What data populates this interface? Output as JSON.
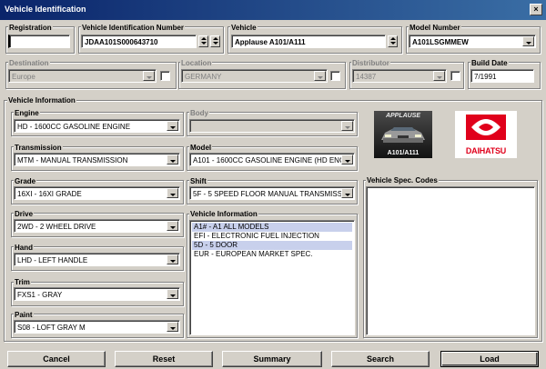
{
  "window": {
    "title": "Vehicle Identification"
  },
  "top": {
    "registration": {
      "label": "Registration",
      "value": ""
    },
    "vin": {
      "label": "Vehicle Identification Number",
      "value": "JDAA101S000643710"
    },
    "vehicle": {
      "label": "Vehicle",
      "value": "Applause A101/A111"
    },
    "model_number": {
      "label": "Model Number",
      "value": "A101LSGMMEW"
    },
    "destination": {
      "label": "Destination",
      "value": "Europe"
    },
    "location": {
      "label": "Location",
      "value": "GERMANY"
    },
    "distributor": {
      "label": "Distributor",
      "value": "14387"
    },
    "build_date": {
      "label": "Build Date",
      "value": "7/1991"
    }
  },
  "info": {
    "label": "Vehicle Information",
    "engine": {
      "label": "Engine",
      "value": "HD - 1600CC GASOLINE ENGINE"
    },
    "body": {
      "label": "Body",
      "value": ""
    },
    "transmission": {
      "label": "Transmission",
      "value": "MTM - MANUAL TRANSMISSION"
    },
    "model": {
      "label": "Model",
      "value": "A101 - 1600CC GASOLINE ENGINE (HD ENGI"
    },
    "grade": {
      "label": "Grade",
      "value": "16XI - 16XI GRADE"
    },
    "shift": {
      "label": "Shift",
      "value": "5F - 5 SPEED FLOOR MANUAL TRANSMISSI"
    },
    "drive": {
      "label": "Drive",
      "value": "2WD - 2 WHEEL DRIVE"
    },
    "hand": {
      "label": "Hand",
      "value": "LHD - LEFT HANDLE"
    },
    "trim": {
      "label": "Trim",
      "value": "FXS1 - GRAY"
    },
    "paint": {
      "label": "Paint",
      "value": "S08 - LOFT GRAY M"
    },
    "list_label": "Vehicle Information",
    "list": [
      {
        "text": "A1# - A1 ALL MODELS",
        "selected": true
      },
      {
        "text": "EFI - ELECTRONIC FUEL INJECTION",
        "selected": false
      },
      {
        "text": "5D - 5 DOOR",
        "selected": true
      },
      {
        "text": "EUR - EUROPEAN MARKET SPEC.",
        "selected": false
      }
    ]
  },
  "images": {
    "car_brand": "APPLAUSE",
    "car_model": "A101/A111",
    "logo_text": "DAIHATSU"
  },
  "spec_codes": {
    "label": "Vehicle Spec. Codes"
  },
  "buttons": {
    "cancel": "Cancel",
    "reset": "Reset",
    "summary": "Summary",
    "search": "Search",
    "load": "Load"
  },
  "colors": {
    "titlebar": "#0a246a",
    "face": "#d4d0c8",
    "selection": "#c8d0ec",
    "logo_red": "#e0001b"
  }
}
